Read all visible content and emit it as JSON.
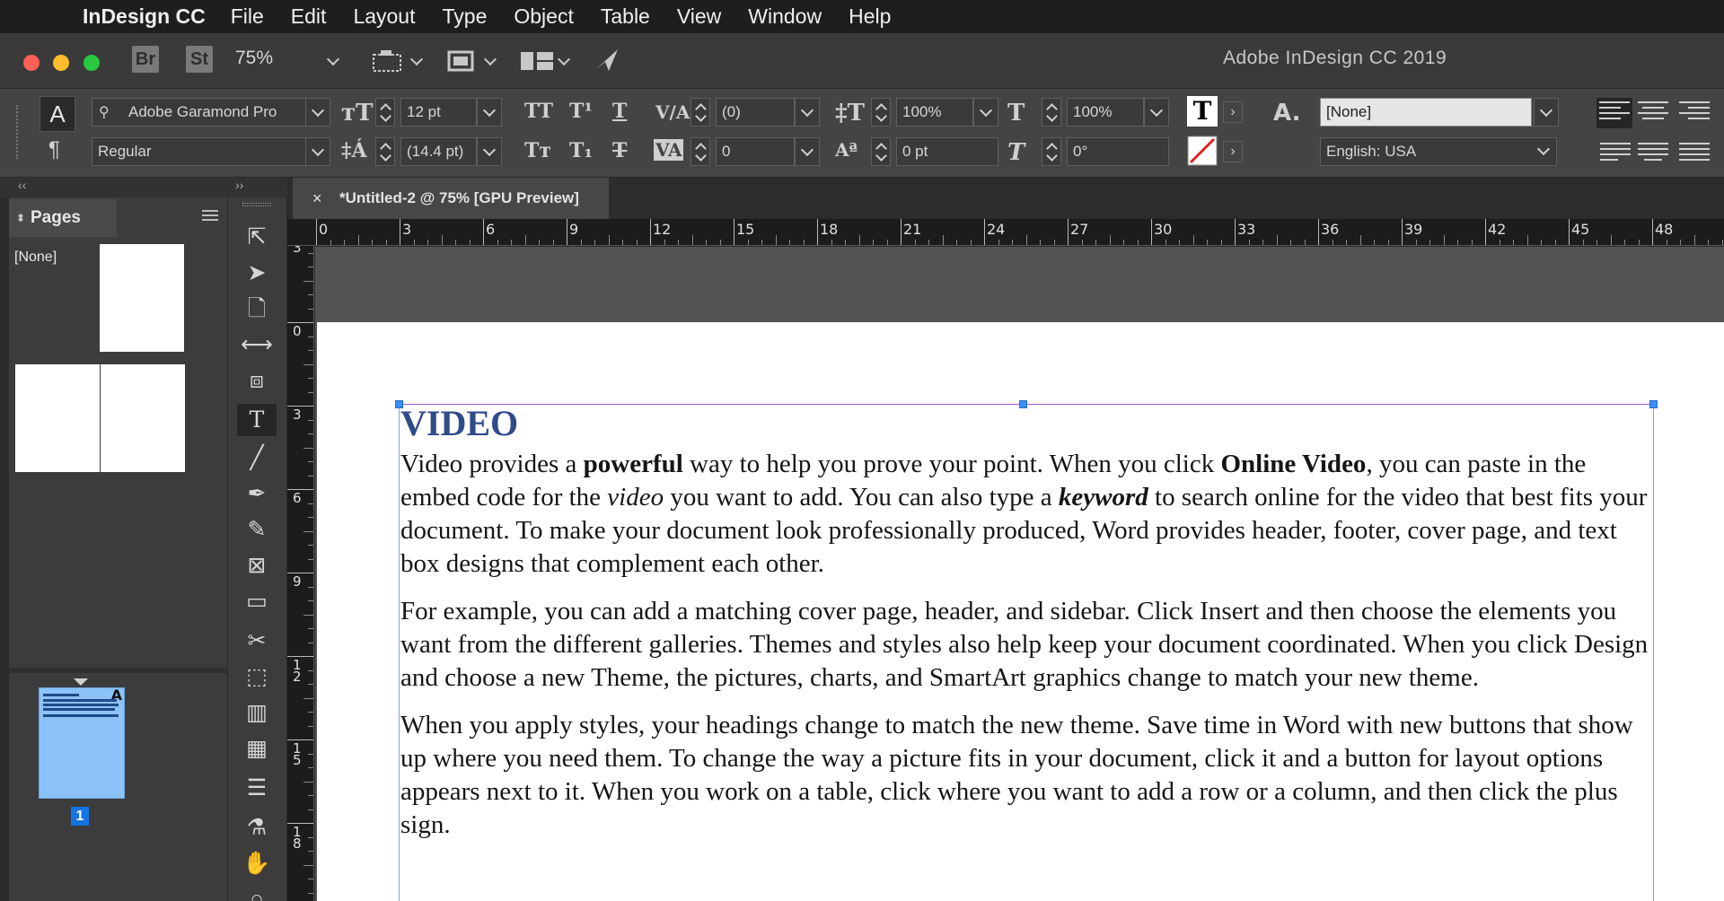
{
  "menubar": {
    "app_name": "InDesign CC",
    "items": [
      "File",
      "Edit",
      "Layout",
      "Type",
      "Object",
      "Table",
      "View",
      "Window",
      "Help"
    ]
  },
  "appbar": {
    "bridge_label": "Br",
    "stock_label": "St",
    "zoom": "75%",
    "window_title": "Adobe InDesign CC 2019"
  },
  "control_panel": {
    "font_family": "Adobe Garamond Pro",
    "font_style": "Regular",
    "font_size": "12 pt",
    "leading": "(14.4 pt)",
    "kerning": "(0)",
    "tracking": "0",
    "vertical_scale": "100%",
    "horizontal_scale": "100%",
    "baseline_shift": "0 pt",
    "skew": "0°",
    "char_style": "[None]",
    "language": "English: USA"
  },
  "pages_panel": {
    "title": "Pages",
    "master_label": "[None]",
    "page_number": "1",
    "master_letter": "A"
  },
  "document": {
    "tab_title": "*Untitled-2 @ 75% [GPU Preview]",
    "tab_close": "×",
    "ruler_h": [
      "0",
      "3",
      "6",
      "9",
      "12",
      "15",
      "18",
      "21",
      "24",
      "27",
      "30",
      "33",
      "36",
      "39",
      "42",
      "45",
      "48"
    ],
    "ruler_v": [
      "3",
      "0",
      "3",
      "6",
      "9",
      "12",
      "15",
      "18"
    ],
    "heading": "VIDEO",
    "p1": {
      "a": "Video provides a ",
      "b": "powerful",
      "c": " way to help you prove your point. When you click ",
      "d": "Online Video",
      "e": ", you can paste in the embed code for the ",
      "f": "video",
      "g": " you want to add. You can also type a ",
      "h": "keyword",
      "i": " to search online for the video that best fits your document. To make your document look professionally produced, Word provides header, footer, cover page, and text box designs that complement each other."
    },
    "p2": "For example, you can add a matching cover page, header, and sidebar. Click Insert and then choose the elements you want from the different galleries. Themes and styles also help keep your document coordinated. When you click Design and choose a new Theme, the pictures, charts, and SmartArt graphics change to match your new theme.",
    "p3": "When you apply styles, your headings change to match the new theme. Save time in Word with new buttons that show up where you need them. To change the way a picture fits in your document, click it and a button for layout options appears next to it. When you work on a table, click where you want to add a row or a column, and then click the plus sign."
  }
}
